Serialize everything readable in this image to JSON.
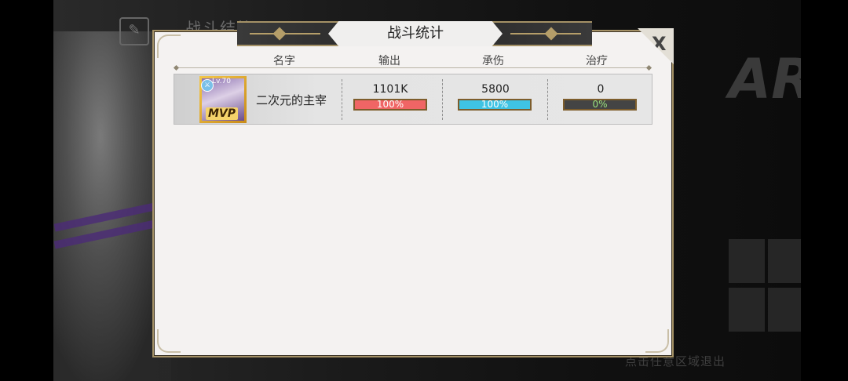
{
  "background": {
    "header_title": "战斗结算",
    "win_text": "AR!",
    "hint": "点击任意区域退出"
  },
  "panel": {
    "title": "战斗统计",
    "close_label": "X"
  },
  "columns": {
    "name": "名字",
    "output": "输出",
    "damage_taken": "承伤",
    "healing": "治疗"
  },
  "players": [
    {
      "level": "Lv.70",
      "badge": "MVP",
      "name": "二次元的主宰",
      "output": {
        "value": "1101K",
        "pct_label": "100%",
        "pct": 100,
        "color": "#f06565"
      },
      "damage_taken": {
        "value": "5800",
        "pct_label": "100%",
        "pct": 100,
        "color": "#3fc3e3"
      },
      "healing": {
        "value": "0",
        "pct_label": "0%",
        "pct": 0,
        "color": "#444444"
      }
    }
  ]
}
